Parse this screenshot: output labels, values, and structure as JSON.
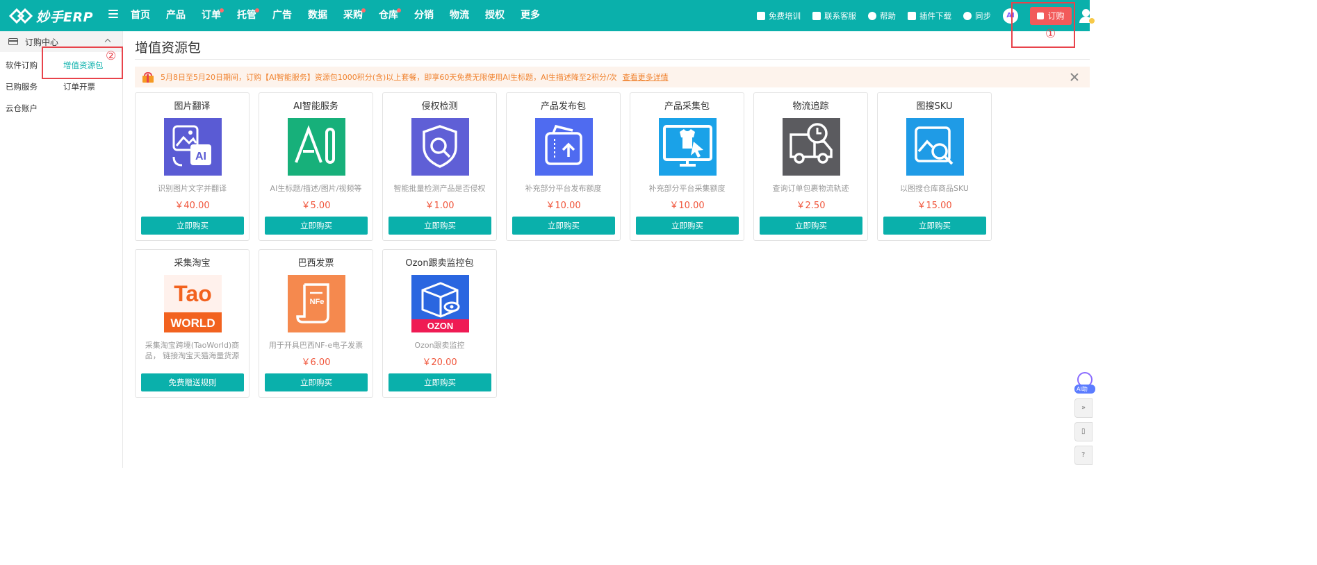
{
  "app": {
    "logo_text": "妙手ERP"
  },
  "nav": [
    {
      "label": "首页",
      "dot": false
    },
    {
      "label": "产品",
      "dot": false
    },
    {
      "label": "订单",
      "dot": true
    },
    {
      "label": "托管",
      "dot": true
    },
    {
      "label": "广告",
      "dot": false
    },
    {
      "label": "数据",
      "dot": false
    },
    {
      "label": "采购",
      "dot": true
    },
    {
      "label": "仓库",
      "dot": true
    },
    {
      "label": "分销",
      "dot": false
    },
    {
      "label": "物流",
      "dot": false
    },
    {
      "label": "授权",
      "dot": false
    },
    {
      "label": "更多",
      "dot": false
    }
  ],
  "toplinks": {
    "training": "免费培训",
    "service": "联系客服",
    "help": "帮助",
    "plugin": "插件下载",
    "sync": "同步",
    "ai_avatar": "AI",
    "order_button": "订购"
  },
  "annotations": {
    "one": "①",
    "two": "②"
  },
  "sidebar": {
    "header": "订购中心",
    "items": [
      "软件订购",
      "增值资源包",
      "已购服务",
      "订单开票",
      "云仓账户"
    ]
  },
  "page": {
    "title": "增值资源包",
    "notice": "5月8日至5月20日期间，订购【AI智能服务】资源包1000积分(含)以上套餐，即享60天免费无限使用AI生标题，AI生描述降至2积分/次",
    "notice_link": "查看更多详情"
  },
  "cards": [
    {
      "title": "图片翻译",
      "desc": "识别图片文字并翻译",
      "price": "￥40.00",
      "button": "立即购买",
      "icon": "image-translate-icon",
      "bg": "#5a5bd4"
    },
    {
      "title": "AI智能服务",
      "desc": "AI生标题/描述/图片/视频等",
      "price": "￥5.00",
      "button": "立即购买",
      "icon": "ai-service-icon",
      "bg": "#17b07a"
    },
    {
      "title": "侵权检测",
      "desc": "智能批量检测产品是否侵权",
      "price": "￥1.00",
      "button": "立即购买",
      "icon": "infringement-shield-icon",
      "bg": "#5f5fd6"
    },
    {
      "title": "产品发布包",
      "desc": "补充部分平台发布额度",
      "price": "￥10.00",
      "button": "立即购买",
      "icon": "product-publish-icon",
      "bg": "#4f6bf0"
    },
    {
      "title": "产品采集包",
      "desc": "补充部分平台采集额度",
      "price": "￥10.00",
      "button": "立即购买",
      "icon": "product-collect-icon",
      "bg": "#1aa2e8"
    },
    {
      "title": "物流追踪",
      "desc": "查询订单包裹物流轨迹",
      "price": "￥2.50",
      "button": "立即购买",
      "icon": "logistics-truck-icon",
      "bg": "#5b5b5f"
    },
    {
      "title": "图搜SKU",
      "desc": "以图搜仓库商品SKU",
      "price": "￥15.00",
      "button": "立即购买",
      "icon": "image-search-icon",
      "bg": "#1f9be6"
    },
    {
      "title": "采集淘宝",
      "desc": "采集淘宝跨境(TaoWorld)商品， 链接淘宝天猫海量货源",
      "price": "",
      "button": "免费赠送规则",
      "icon": "taoworld-logo-icon",
      "bg": "#fff1ec",
      "logo_top": "Tao",
      "logo_bottom": "WORLD"
    },
    {
      "title": "巴西发票",
      "desc": "用于开具巴西NF-e电子发票",
      "price": "￥6.00",
      "button": "立即购买",
      "icon": "nfe-invoice-icon",
      "bg": "#f5894e",
      "logo_top": "NFe"
    },
    {
      "title": "Ozon跟卖监控包",
      "desc": "Ozon跟卖监控",
      "price": "￥20.00",
      "button": "立即购买",
      "icon": "ozon-monitor-icon",
      "bg": "#2a66e0",
      "logo_bottom": "OZON"
    }
  ],
  "float": {
    "ai_label": "AI助"
  }
}
